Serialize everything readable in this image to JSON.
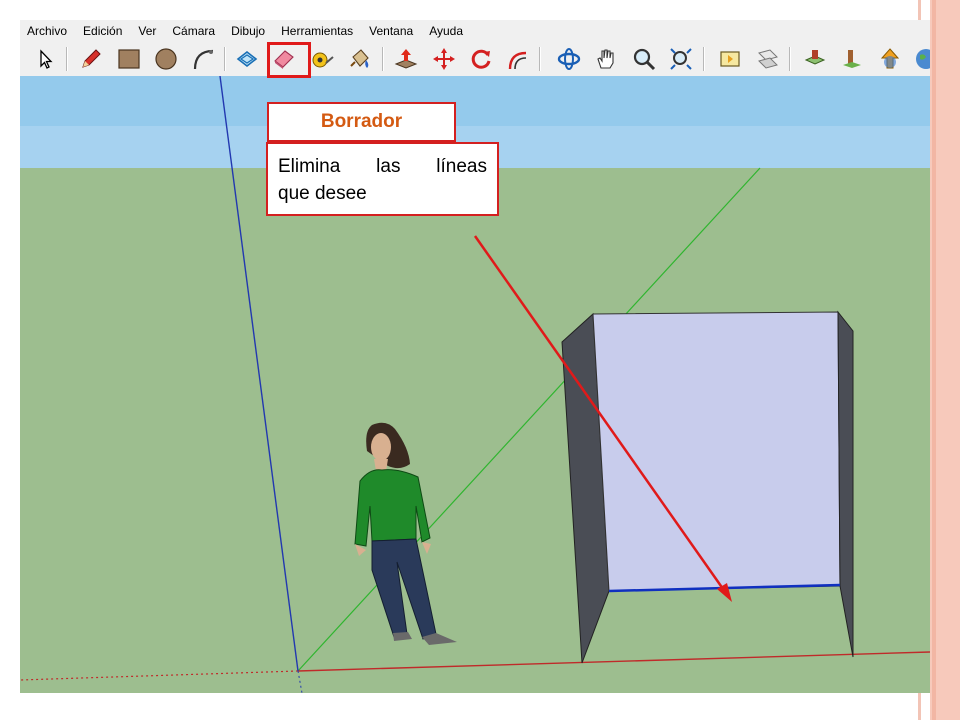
{
  "menu": {
    "items": [
      "Archivo",
      "Edición",
      "Ver",
      "Cámara",
      "Dibujo",
      "Herramientas",
      "Ventana",
      "Ayuda"
    ]
  },
  "toolbar": {
    "tools": [
      "select-icon",
      "pencil-icon",
      "rectangle-icon",
      "circle-icon",
      "arc-icon",
      "make-component-icon",
      "eraser-icon",
      "tape-measure-icon",
      "paint-bucket-icon",
      "push-pull-icon",
      "move-icon",
      "rotate-icon",
      "offset-icon",
      "orbit-icon",
      "pan-icon",
      "zoom-icon",
      "zoom-extents-icon",
      "previous-view-icon",
      "next-view-icon",
      "warehouse-icon",
      "place-model-icon",
      "share-model-icon",
      "earth-icon"
    ],
    "active_tool": "eraser-icon"
  },
  "callout": {
    "title": "Borrador",
    "description_line1": "Elimina las líneas",
    "description_line2": "que desee",
    "accent_color": "#e01a1a",
    "title_color": "#d45a12"
  },
  "scene": {
    "sky_color": "#a6d2f0",
    "ground_color": "#9dbe8f",
    "wall_front_color": "#c8ccec",
    "wall_side_color": "#4a4d55"
  }
}
